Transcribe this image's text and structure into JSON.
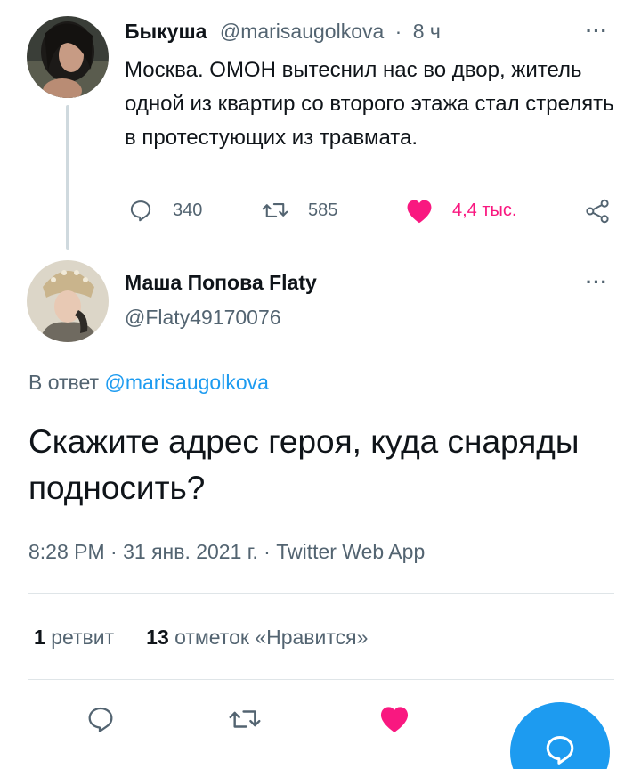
{
  "tweet1": {
    "display_name": "Быкуша",
    "handle": "@marisaugolkova",
    "separator": "·",
    "time": "8 ч",
    "text": "Москва. ОМОН вытеснил нас во двор, житель одной из квартир со второго этажа стал стрелять в протестующих из травмата.",
    "replies": "340",
    "retweets": "585",
    "likes": "4,4 тыс."
  },
  "tweet2": {
    "display_name": "Маша Попова Flaty",
    "handle": "@Flaty49170076",
    "reply_prefix": "В ответ",
    "reply_handle": "@marisaugolkova",
    "text": "Скажите адрес героя, куда снаряды подносить?",
    "meta": "8:28 PM · 31 янв. 2021 г. · Twitter Web App",
    "retweet_count": "1",
    "retweet_label": "ретвит",
    "like_count": "13",
    "like_label": "отметок «Нравится»"
  },
  "more_glyph": "···",
  "colors": {
    "accent": "#1d9bf0",
    "like": "#f91880",
    "muted": "#536471",
    "thread_line": "#cfd9de"
  },
  "icons": [
    "reply-icon",
    "retweet-icon",
    "heart-icon",
    "share-icon",
    "more-icon",
    "compose-icon"
  ]
}
